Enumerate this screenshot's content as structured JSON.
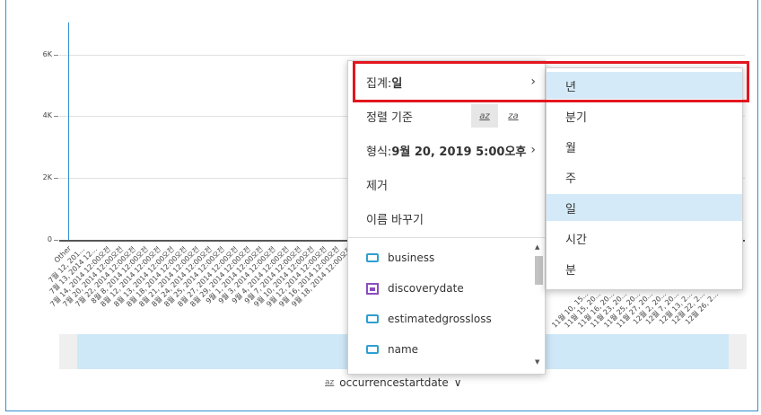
{
  "chart": {
    "y_ticks": [
      "6K",
      "4K",
      "2K",
      "0"
    ],
    "x_labels_left": [
      "Other",
      "7월 12, 201...",
      "7월 13, 2014 12...",
      "7월 14, 2014 12:00오전",
      "7월 20, 2014 12:00오전",
      "7월 22, 2014 12:00오전",
      "8월 8, 2014 12:00오전",
      "8월 12, 2014 12:00오전",
      "8월 13, 2014 12:00오전",
      "8월 18, 2014 12:00오전",
      "8월 21, 2014 12:00오전",
      "8월 24, 2014 12:00오전",
      "8월 25, 2014 12:00오전",
      "8월 27, 2014 12:00오전",
      "8월 29, 2014 12:00오전",
      "9월 1, 2014 12:00오전",
      "9월 3, 2014 12:00오전",
      "9월 4, 2014 12:00오전",
      "9월 7, 2014 12:00오전",
      "9월 10, 2014 12:00오전",
      "9월 12, 2014 12:00오전",
      "9월 16, 2014 12:00오전",
      "9월 18, 2014 12:00오전"
    ],
    "x_labels_right": [
      "11월 10, 15...",
      "11월 15, 20...",
      "11월 16, 20...",
      "11월 23, 20...",
      "11월 25, 20...",
      "11월 27, 20...",
      "12월 2, 20...",
      "12월 7, 20...",
      "12월 13, 2...",
      "12월 22, 2...",
      "12월 26, 2..."
    ]
  },
  "field_well": {
    "sort_glyph": "az",
    "label": "occurrencestartdate",
    "chevron": "∨"
  },
  "context_menu": {
    "aggregate_label": "집계: ",
    "aggregate_value": "일",
    "sort_label": "정렬 기준",
    "sort_asc": "az",
    "sort_desc": "za",
    "format_label": "형식: ",
    "format_value": "9월 20, 2019 5:00오후",
    "remove_label": "제거",
    "rename_label": "이름 바꾸기",
    "fields": [
      "business",
      "discoverydate",
      "estimatedgrossloss",
      "name"
    ]
  },
  "submenu": {
    "items": [
      "년",
      "분기",
      "월",
      "주",
      "일",
      "시간",
      "분"
    ],
    "highlighted": [
      "년",
      "일"
    ]
  },
  "colors": {
    "accent": "#2f8fd1",
    "highlight": "#d5eaf8",
    "annotation": "#e3161f"
  }
}
